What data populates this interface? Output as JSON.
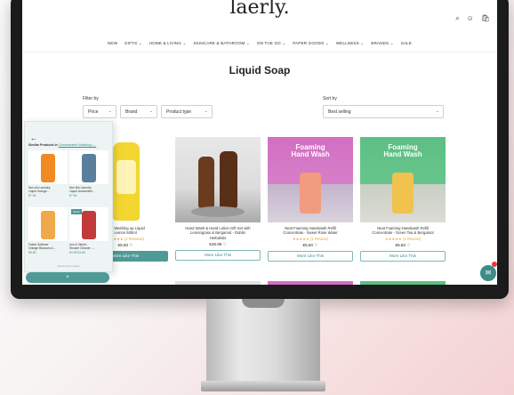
{
  "site": {
    "logo": "laerly.",
    "nav": [
      "NEW",
      "GIFTS ⌄",
      "HOME & LIVING ⌄",
      "SKINCARE & BATHROOM ⌄",
      "ON THE GO ⌄",
      "PAPER GOODS ⌄",
      "WELLNESS ⌄",
      "BRANDS ⌄",
      "SALE"
    ],
    "header_icons": [
      "search-icon",
      "account-icon",
      "cart-icon"
    ]
  },
  "page": {
    "title": "Liquid Soap",
    "filter_label": "Filter by",
    "filters": [
      "Price",
      "Brand",
      "Product type"
    ],
    "sort_label": "Sort by",
    "sort_value": "Best selling"
  },
  "products": [
    {
      "name": "...ed Washing up Liquid\nLemon 500ml",
      "rating": "★★★★★ (2 Reviews)",
      "price": "€5.50 ♡",
      "button": "More Like This"
    },
    {
      "name": "Hand Wash & Hand Lotion Gift Set with\nLemongrass & Bergamot - Dublin\nHerbalists",
      "rating": "",
      "price": "€28.95 ♡",
      "button": "More Like This"
    },
    {
      "name": "Neat Foaming Handwash Refill\nConcentrate - Sweet Rose Water",
      "rating": "★★★★★ (1 Review)",
      "price": "€5.50 ♡",
      "button": "More Like This",
      "image_text": "Foaming\nHand Wash"
    },
    {
      "name": "Neat Foaming Handwash Refill\nConcentrate - Green Tea & Bergamot",
      "rating": "★★★★★ (1 Review)",
      "price": "€5.50 ♡",
      "button": "More Like This",
      "image_text": "Foaming\nHand Wash"
    }
  ],
  "side_panel": {
    "back": "←",
    "heading": "Similar Products in",
    "heading_link": "Concentrated Washing L...",
    "items": [
      {
        "name": "Non-bio Laundry\nLiquid Orange...",
        "price": "€7.50"
      },
      {
        "name": "Non Bio Laundry\nLiquid Unscented...",
        "price": "€7.50"
      },
      {
        "name": "Fabric Softener\nOrange Blossom &...",
        "price": "€5.80"
      },
      {
        "name": "Iron & Velvet -\nShower Cleaner -...",
        "price": "€3.95  €4.65"
      }
    ],
    "badge": "SALE",
    "footer": "Powered by Laerly",
    "close": "×"
  },
  "colors": {
    "teal": "#4f9a96",
    "pink": "#d46ec4",
    "green": "#5cbf84"
  }
}
